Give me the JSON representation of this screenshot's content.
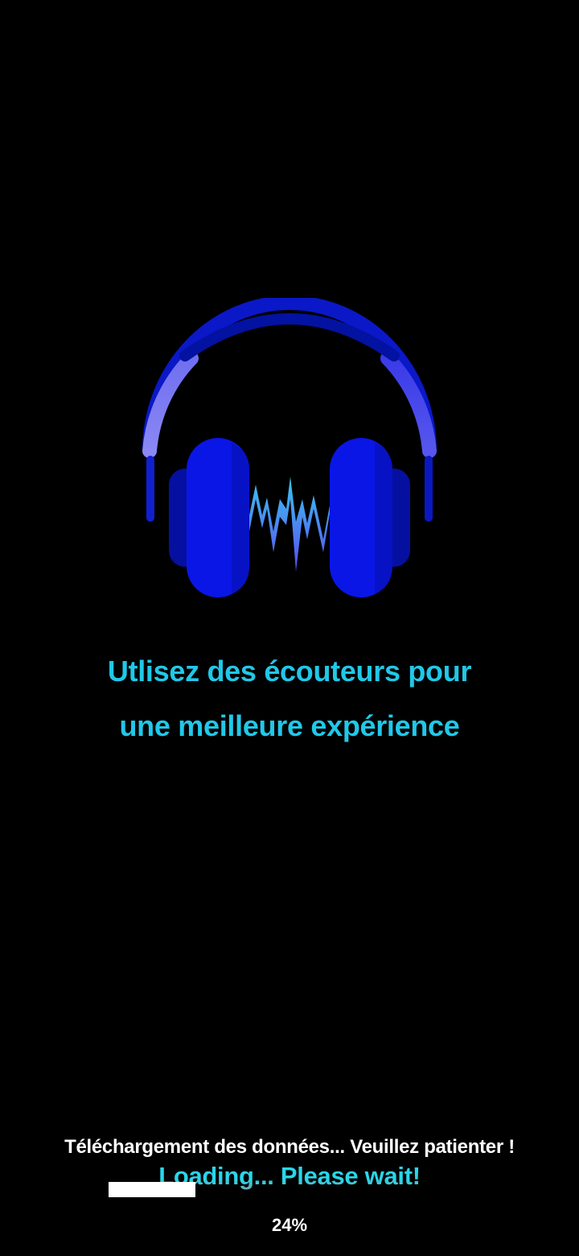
{
  "splash": {
    "logo_icon": "headphones-soundwave-icon",
    "tagline_line1": "Utlisez des écouteurs pour",
    "tagline_line2": "une meilleure expérience"
  },
  "loading": {
    "message_fr": "Téléchargement des données... Veuillez patienter !",
    "message_en": "Loading... Please wait!",
    "progress": 0.24,
    "percent_label": "24%"
  },
  "colors": {
    "background": "#000000",
    "tagline": "#20c8e8",
    "headphone_blue": "#0a14e6",
    "headphone_dark": "#0010a8",
    "band_light": "#7b7df0",
    "wave": "#3aa8f0",
    "progress_fill": "#ffffff"
  }
}
